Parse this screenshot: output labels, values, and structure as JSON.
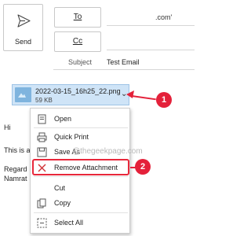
{
  "compose": {
    "send_label": "Send",
    "to_label": "To",
    "cc_label": "Cc",
    "to_value": ".com'",
    "subject_label": "Subject",
    "subject_value": "Test Email"
  },
  "attachment": {
    "file_name": "2022-03-15_16h25_22.png",
    "file_size": "59 KB"
  },
  "body": {
    "greeting": "Hi",
    "line1": "This is a",
    "regards": "Regard",
    "name": "Namrat"
  },
  "context_menu": {
    "items": [
      {
        "label": "Open",
        "icon": "open-icon"
      },
      {
        "label": "Quick Print",
        "icon": "print-icon"
      },
      {
        "label": "Save As",
        "icon": "save-icon"
      },
      {
        "label": "Remove Attachment",
        "icon": "remove-icon"
      },
      {
        "label": "Cut",
        "icon": "cut-icon"
      },
      {
        "label": "Copy",
        "icon": "copy-icon"
      },
      {
        "label": "Select All",
        "icon": "select-all-icon"
      }
    ]
  },
  "annotations": {
    "badge1": "1",
    "badge2": "2",
    "watermark": "@thegeekpage.com",
    "color": "#e4213a"
  }
}
